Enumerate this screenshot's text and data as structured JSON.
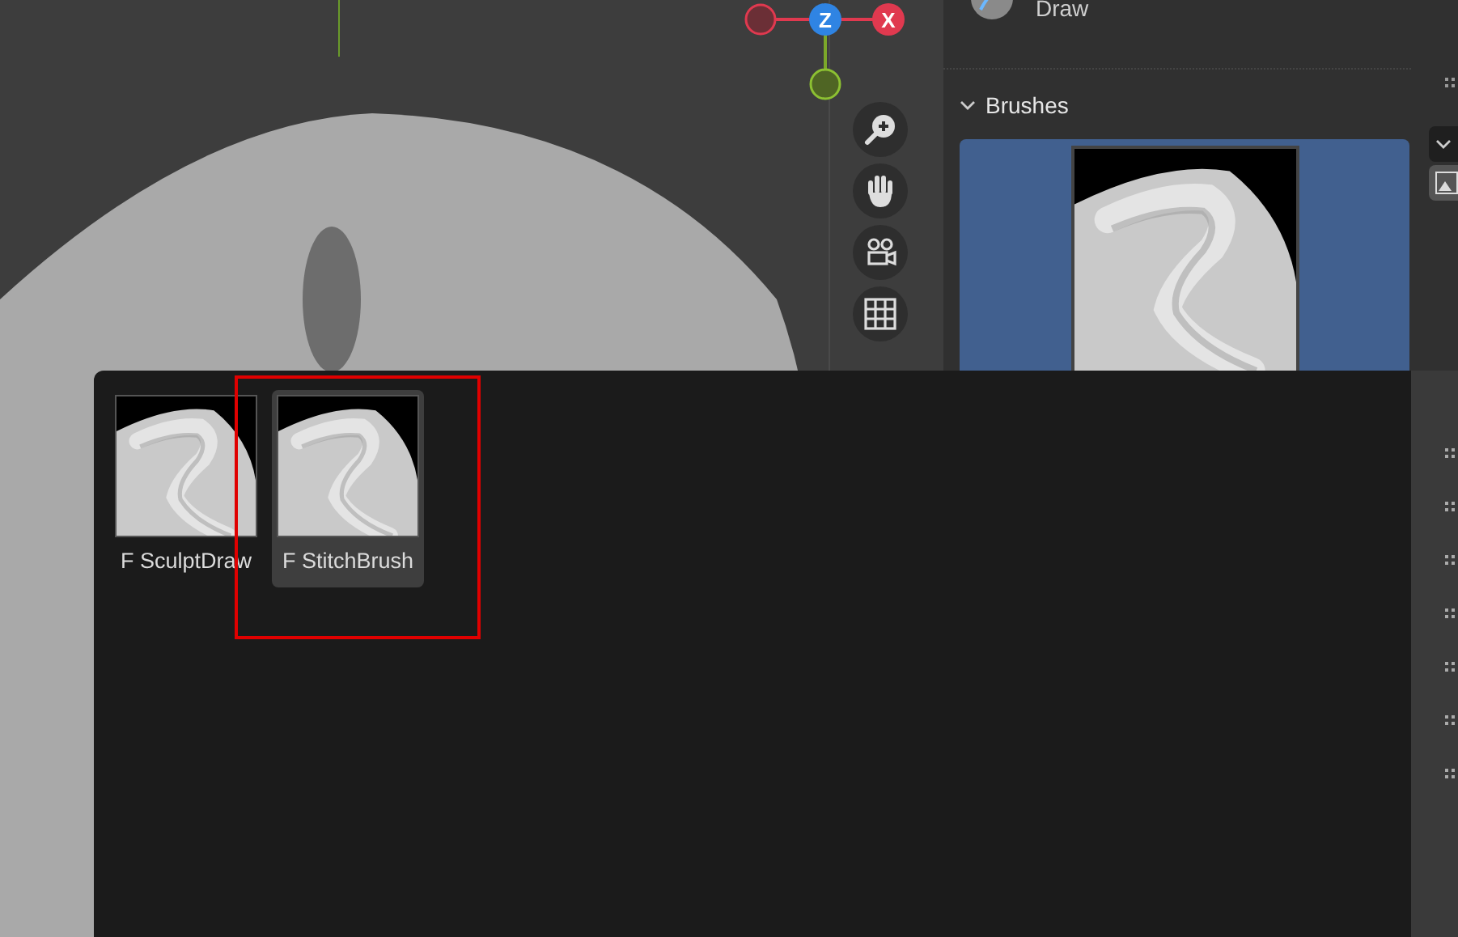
{
  "gizmo": {
    "axes": [
      {
        "label": "Z",
        "color": "#2f84e3"
      },
      {
        "label": "X",
        "color": "#e0394f"
      }
    ]
  },
  "tool": {
    "name": "Draw"
  },
  "brushes_panel": {
    "title": "Brushes",
    "expanded": true
  },
  "brush_popup": {
    "items": [
      {
        "label": "F SculptDraw",
        "selected": false
      },
      {
        "label": "F StitchBrush",
        "selected": true
      }
    ]
  }
}
